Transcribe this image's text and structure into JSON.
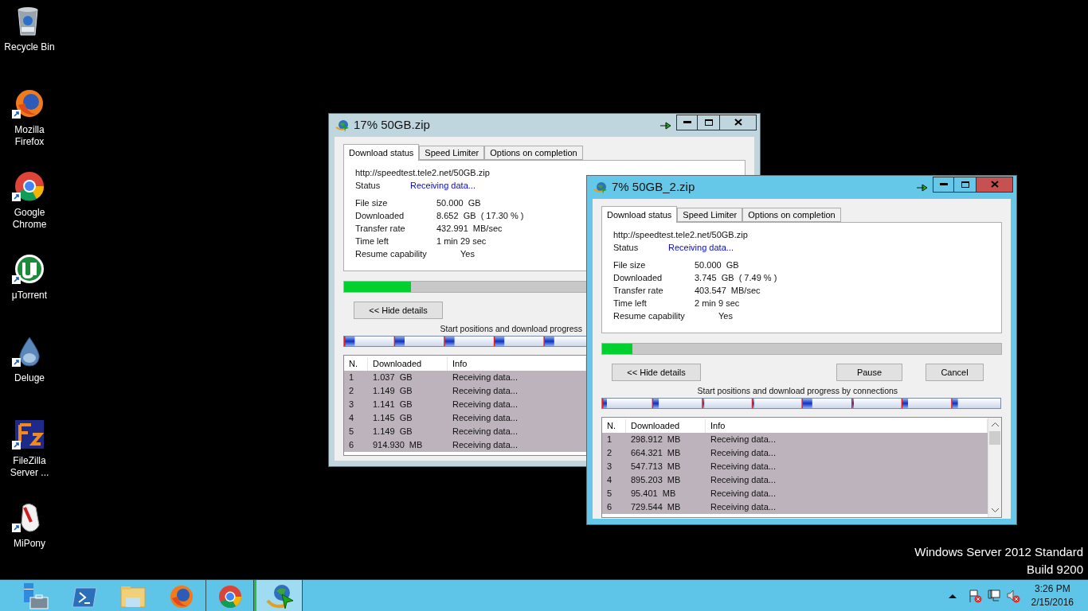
{
  "desktop_icons": [
    {
      "label": "Recycle Bin"
    },
    {
      "label": "Mozilla Firefox"
    },
    {
      "label": "Google Chrome"
    },
    {
      "label": "μTorrent"
    },
    {
      "label": "Deluge"
    },
    {
      "label": "FileZilla Server ..."
    },
    {
      "label": "MiPony"
    }
  ],
  "windows": [
    {
      "title": "17% 50GB.zip",
      "active": false,
      "tabs": [
        {
          "label": "Download status",
          "selected": true
        },
        {
          "label": "Speed Limiter",
          "selected": false
        },
        {
          "label": "Options on completion",
          "selected": false
        }
      ],
      "url": "http://speedtest.tele2.net/50GB.zip",
      "status": {
        "label": "Status",
        "value": "Receiving data..."
      },
      "fields": [
        {
          "label": "File size",
          "value": "50.000  GB"
        },
        {
          "label": "Downloaded",
          "value": "8.652  GB  ( 17.30 % )"
        },
        {
          "label": "Transfer rate",
          "value": "432.991  MB/sec"
        },
        {
          "label": "Time left",
          "value": "1 min 29 sec"
        },
        {
          "label": "Resume capability",
          "value": "Yes"
        }
      ],
      "buttons": [
        {
          "label": "<< Hide details"
        }
      ],
      "connections_label": "Start positions and download progress",
      "table": {
        "columns": [
          "N.",
          "Downloaded",
          "Info"
        ],
        "rows": [
          [
            "1",
            "1.037  GB",
            "Receiving data..."
          ],
          [
            "2",
            "1.149  GB",
            "Receiving data..."
          ],
          [
            "3",
            "1.141  GB",
            "Receiving data..."
          ],
          [
            "4",
            "1.145  GB",
            "Receiving data..."
          ],
          [
            "5",
            "1.149  GB",
            "Receiving data..."
          ],
          [
            "6",
            "914.930  MB",
            "Receiving data..."
          ]
        ]
      }
    },
    {
      "title": "7% 50GB_2.zip",
      "active": true,
      "tabs": [
        {
          "label": "Download status",
          "selected": true
        },
        {
          "label": "Speed Limiter",
          "selected": false
        },
        {
          "label": "Options on completion",
          "selected": false
        }
      ],
      "url": "http://speedtest.tele2.net/50GB.zip",
      "status": {
        "label": "Status",
        "value": "Receiving data..."
      },
      "fields": [
        {
          "label": "File size",
          "value": "50.000  GB"
        },
        {
          "label": "Downloaded",
          "value": "3.745  GB  ( 7.49 % )"
        },
        {
          "label": "Transfer rate",
          "value": "403.547  MB/sec"
        },
        {
          "label": "Time left",
          "value": "2 min 9 sec"
        },
        {
          "label": "Resume capability",
          "value": "Yes"
        }
      ],
      "progress": {
        "level": 0.0749
      },
      "buttons": [
        {
          "label": "<< Hide details"
        },
        {
          "label": "Pause"
        },
        {
          "label": "Cancel"
        }
      ],
      "connections_label": "Start positions and download progress by connections",
      "table": {
        "columns": [
          "N.",
          "Downloaded",
          "Info"
        ],
        "rows": [
          [
            "1",
            "298.912  MB",
            "Receiving data..."
          ],
          [
            "2",
            "664.321  MB",
            "Receiving data..."
          ],
          [
            "3",
            "547.713  MB",
            "Receiving data..."
          ],
          [
            "4",
            "895.203  MB",
            "Receiving data..."
          ],
          [
            "5",
            "95.401  MB",
            "Receiving data..."
          ],
          [
            "6",
            "729.544  MB",
            "Receiving data..."
          ]
        ]
      }
    }
  ],
  "os_info": [
    "Windows Server 2012 Standard",
    "Build 9200"
  ],
  "taskbar": {
    "items": [
      {
        "running": false,
        "active": false
      },
      {
        "running": false,
        "active": false
      },
      {
        "running": false,
        "active": false
      },
      {
        "running": false,
        "active": false
      },
      {
        "running": true,
        "active": false
      },
      {
        "running": true,
        "active": true
      }
    ],
    "clock": {
      "time": "3:26 PM",
      "date": "2/15/2016"
    }
  }
}
